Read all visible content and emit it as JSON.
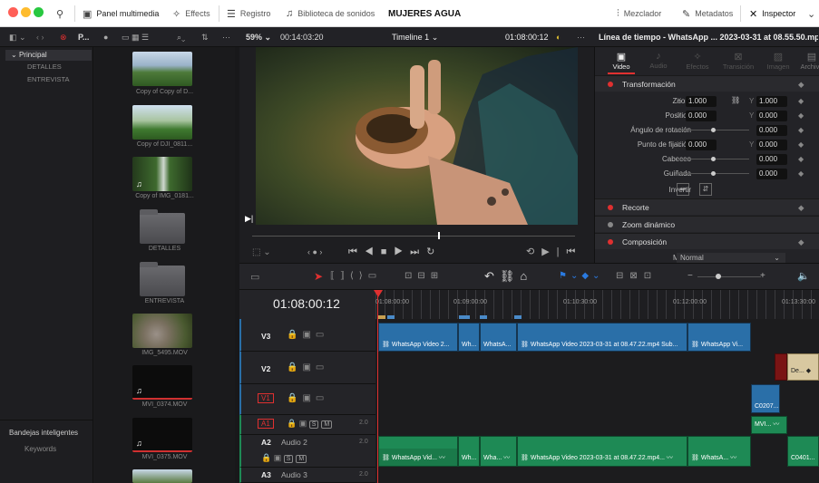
{
  "toolbar": {
    "media_pool": "Panel multimedia",
    "effects": "Effects",
    "index": "Registro",
    "sound_library": "Biblioteca de sonidos",
    "project_title": "MUJERES AGUA",
    "mixer": "Mezclador",
    "metadata": "Metadatos",
    "inspector": "Inspector"
  },
  "subbar": {
    "pool_label": "P...",
    "zoom": "59%",
    "src_timecode": "00:14:03:20",
    "timeline_name": "Timeline 1",
    "rec_timecode": "01:08:00:12",
    "inspector_title": "Línea de tiempo - WhatsApp ... 2023-03-31 at 08.55.50.mp4"
  },
  "bins": {
    "root": "Principal",
    "children": [
      "DETALLES",
      "ENTREVISTA"
    ],
    "smart_bins": "Bandejas inteligentes",
    "keywords": "Keywords"
  },
  "clips": [
    "Copy of Copy of D...",
    "Copy of DJI_0811...",
    "Copy of IMG_0181...",
    "DETALLES",
    "ENTREVISTA",
    "IMG_5495.MOV",
    "MVI_0374.MOV",
    "MVI_0375.MOV"
  ],
  "inspector": {
    "tabs": [
      "Video",
      "Audio",
      "Efectos",
      "Transición",
      "Imagen",
      "Archivo"
    ],
    "transform": "Transformación",
    "rows": [
      {
        "label": "Zoom",
        "x": "1.000",
        "y": "1.000"
      },
      {
        "label": "Position",
        "x": "0.000",
        "y": "0.000"
      },
      {
        "label": "Ángulo de rotación",
        "v": "0.000"
      },
      {
        "label": "Punto de fijación",
        "x": "0.000",
        "y": "0.000"
      },
      {
        "label": "Cabeceo",
        "v": "0.000"
      },
      {
        "label": "Guiñada",
        "v": "0.000"
      },
      {
        "label": "Invertir"
      }
    ],
    "crop": "Recorte",
    "dynamic_zoom": "Zoom dinámico",
    "composite": "Composición",
    "mode_label": "Modo",
    "mode_value": "Normal"
  },
  "timeline": {
    "timecode": "01:08:00:12",
    "ruler": [
      "01:08:00:00",
      "01:09:00:00",
      "01:10:30:00",
      "01:12:00:00",
      "01:13:30:00"
    ],
    "tracks": [
      {
        "name": "V3"
      },
      {
        "name": "V2"
      },
      {
        "name": "V1"
      },
      {
        "name": "A1",
        "level": "2.0"
      },
      {
        "name": "A2",
        "label": "Audio 2",
        "level": "2.0"
      },
      {
        "name": "A3",
        "label": "Audio 3",
        "level": "2.0"
      }
    ],
    "v3_clips": [
      "WhatsApp Video 2...",
      "Wh...",
      "WhatsA...",
      "WhatsApp Video 2023-03-31 at 08.47.22.mp4 Sub...",
      "WhatsApp Vi..."
    ],
    "v1_clip": "C0207...",
    "v_right": "De...",
    "a1_clip": "MVI...",
    "a2_clips": [
      "WhatsApp Vid...",
      "Wh...",
      "Wha...",
      "WhatsApp Video 2023-03-31 at 08.47.22.mp4...",
      "WhatsA..."
    ],
    "a2_right": "C0401..."
  },
  "colors": {
    "accent_red": "#e03030",
    "video_clip": "#2a6fa8",
    "audio_clip": "#1e8a55"
  }
}
